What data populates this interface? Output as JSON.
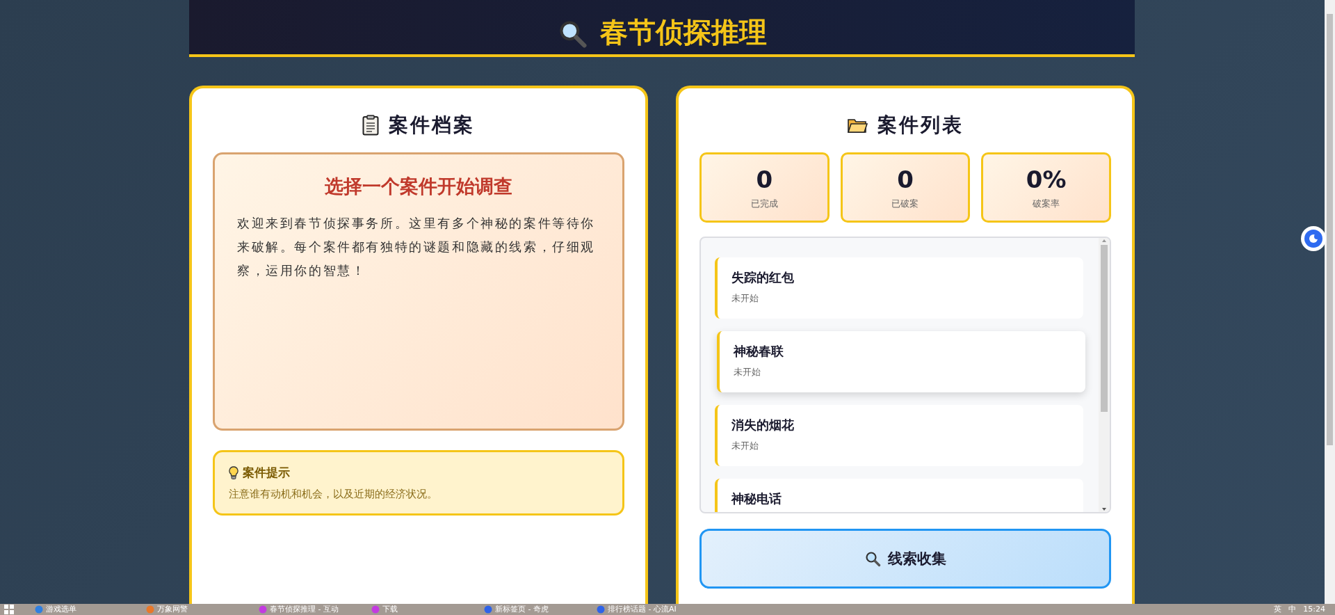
{
  "header": {
    "title": "春节侦探推理"
  },
  "case_file": {
    "title": "案件档案",
    "heading": "选择一个案件开始调查",
    "intro": "欢迎来到春节侦探事务所。这里有多个神秘的案件等待你来破解。每个案件都有独特的谜题和隐藏的线索，仔细观察，运用你的智慧！",
    "hint": {
      "title": "案件提示",
      "text": "注意谁有动机和机会，以及近期的经济状况。"
    }
  },
  "case_list": {
    "title": "案件列表",
    "stats": [
      {
        "value": "0",
        "label": "已完成"
      },
      {
        "value": "0",
        "label": "已破案"
      },
      {
        "value": "0%",
        "label": "破案率"
      }
    ],
    "cases": [
      {
        "title": "失踪的红包",
        "status": "未开始",
        "hovered": false
      },
      {
        "title": "神秘春联",
        "status": "未开始",
        "hovered": true
      },
      {
        "title": "消失的烟花",
        "status": "未开始",
        "hovered": false
      },
      {
        "title": "神秘电话",
        "hovered": false
      }
    ],
    "button": "线索收集"
  },
  "taskbar": {
    "items": [
      {
        "label": "游戏选单",
        "color": "#2f7fe0"
      },
      {
        "label": "万象网警",
        "color": "#e8782a"
      },
      {
        "label": "春节侦探推理 - 互动",
        "color": "#c33be0"
      },
      {
        "label": "下载",
        "color": "#c33be0"
      },
      {
        "label": "新标签页 - 奇虎",
        "color": "#2f63e8"
      },
      {
        "label": "排行榜话题 - 心流AI",
        "color": "#2f63e8"
      }
    ],
    "tray": [
      "英",
      "中"
    ],
    "time": "15:24"
  }
}
